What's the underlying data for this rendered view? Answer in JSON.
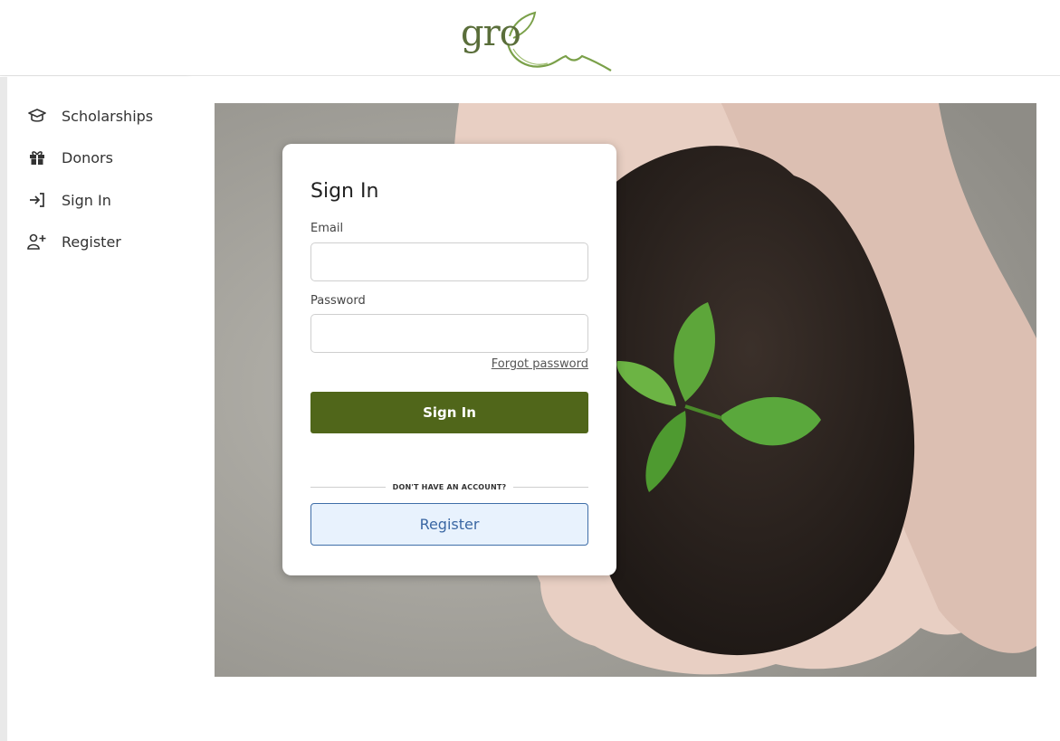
{
  "brand": {
    "logo_text": "gro",
    "accent": "#50661a"
  },
  "sidebar": {
    "items": [
      {
        "label": "Scholarships",
        "icon": "graduation-cap-icon"
      },
      {
        "label": "Donors",
        "icon": "gift-icon"
      },
      {
        "label": "Sign In",
        "icon": "sign-in-icon"
      },
      {
        "label": "Register",
        "icon": "user-plus-icon"
      }
    ]
  },
  "hero": {
    "image": "hands-holding-soil-with-seedling"
  },
  "signin": {
    "title": "Sign In",
    "email_label": "Email",
    "email_value": "",
    "password_label": "Password",
    "password_value": "",
    "forgot_label": "Forgot password",
    "submit_label": "Sign In",
    "divider_text": "DON'T HAVE AN ACCOUNT?",
    "register_label": "Register"
  }
}
